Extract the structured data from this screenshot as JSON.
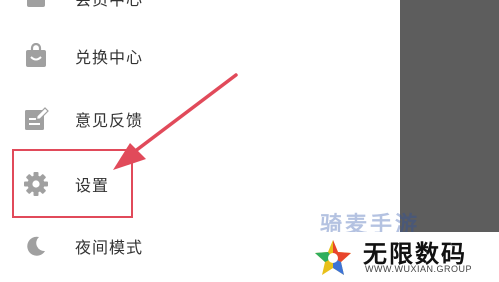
{
  "menu": {
    "top_partial_label": "会员中心",
    "items": [
      {
        "label": "兑换中心",
        "icon": "shopping-bag-icon"
      },
      {
        "label": "意见反馈",
        "icon": "edit-note-icon"
      },
      {
        "label": "设置",
        "icon": "gear-icon"
      },
      {
        "label": "夜间模式",
        "icon": "moon-icon"
      }
    ]
  },
  "annotation": {
    "color": "#e14a5a"
  },
  "watermark": {
    "faded_text": "骑麦手游",
    "title": "无限数码",
    "subtitle": "WWW.WUXIAN.GROUP"
  },
  "colors": {
    "icon": "#a0a0a0",
    "label": "#333333",
    "overlay": "#5d5d5d"
  }
}
